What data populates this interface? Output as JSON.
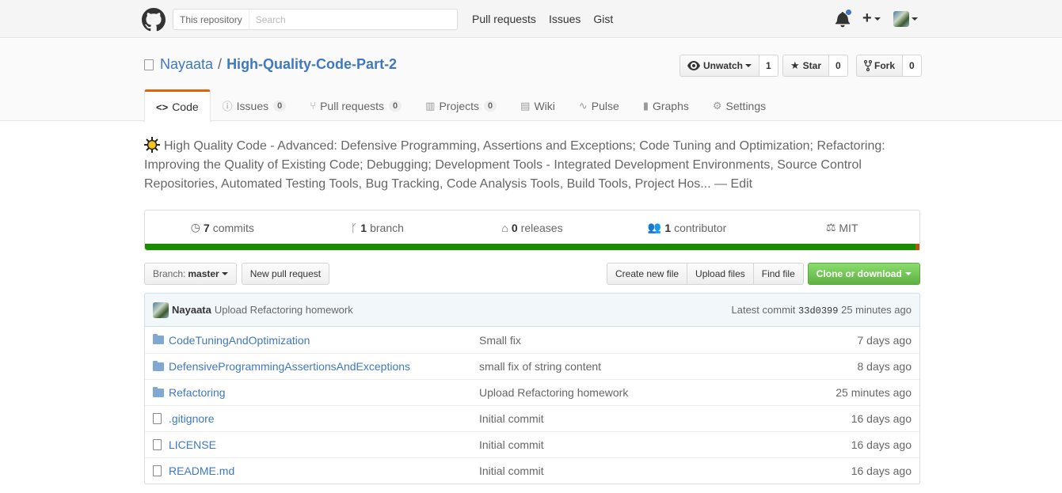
{
  "header": {
    "search_scope": "This repository",
    "search_placeholder": "Search",
    "nav": [
      "Pull requests",
      "Issues",
      "Gist"
    ]
  },
  "repo": {
    "owner": "Nayaata",
    "separator": "/",
    "name": "High-Quality-Code-Part-2",
    "watch_label": "Unwatch",
    "watch_count": "1",
    "star_label": "Star",
    "star_count": "0",
    "fork_label": "Fork",
    "fork_count": "0"
  },
  "tabs": [
    {
      "label": "Code",
      "icon": "code-icon",
      "count": ""
    },
    {
      "label": "Issues",
      "icon": "issue-icon",
      "count": "0"
    },
    {
      "label": "Pull requests",
      "icon": "pull-request-icon",
      "count": "0"
    },
    {
      "label": "Projects",
      "icon": "project-icon",
      "count": "0"
    },
    {
      "label": "Wiki",
      "icon": "book-icon",
      "count": ""
    },
    {
      "label": "Pulse",
      "icon": "pulse-icon",
      "count": ""
    },
    {
      "label": "Graphs",
      "icon": "graph-icon",
      "count": ""
    },
    {
      "label": "Settings",
      "icon": "gear-icon",
      "count": ""
    }
  ],
  "description": {
    "text": "High Quality Code - Advanced: Defensive Programming, Assertions and Exceptions; Code Tuning and Optimization; Refactoring: Improving the Quality of Existing Code; Debugging; Development Tools - Integrated Development Environments, Source Control Repositories, Automated Testing Tools, Bug Tracking, Code Analysis Tools, Build Tools, Project Hos...",
    "edit_label": "— Edit"
  },
  "summary": {
    "commits_count": "7",
    "commits_label": "commits",
    "branch_count": "1",
    "branch_label": "branch",
    "releases_count": "0",
    "releases_label": "releases",
    "contributor_count": "1",
    "contributor_label": "contributor",
    "license": "MIT"
  },
  "languages": {
    "primary_color": "#1a8a00",
    "secondary_color": "#ad5a10"
  },
  "file_nav": {
    "branch_prefix": "Branch:",
    "branch_name": "master",
    "new_pr": "New pull request",
    "create_file": "Create new file",
    "upload_files": "Upload files",
    "find_file": "Find file",
    "clone": "Clone or download"
  },
  "latest_commit": {
    "author": "Nayaata",
    "message": "Upload Refactoring homework",
    "prefix": "Latest commit",
    "sha": "33d0399",
    "age": "25 minutes ago"
  },
  "files": [
    {
      "name": "CodeTuningAndOptimization",
      "type": "folder",
      "message": "Small fix",
      "age": "7 days ago"
    },
    {
      "name": "DefensiveProgrammingAssertionsAndExceptions",
      "type": "folder",
      "message": "small fix of string content",
      "age": "8 days ago"
    },
    {
      "name": "Refactoring",
      "type": "folder",
      "message": "Upload Refactoring homework",
      "age": "25 minutes ago"
    },
    {
      "name": ".gitignore",
      "type": "file",
      "message": "Initial commit",
      "age": "16 days ago"
    },
    {
      "name": "LICENSE",
      "type": "file",
      "message": "Initial commit",
      "age": "16 days ago"
    },
    {
      "name": "README.md",
      "type": "file",
      "message": "Initial commit",
      "age": "16 days ago"
    }
  ]
}
